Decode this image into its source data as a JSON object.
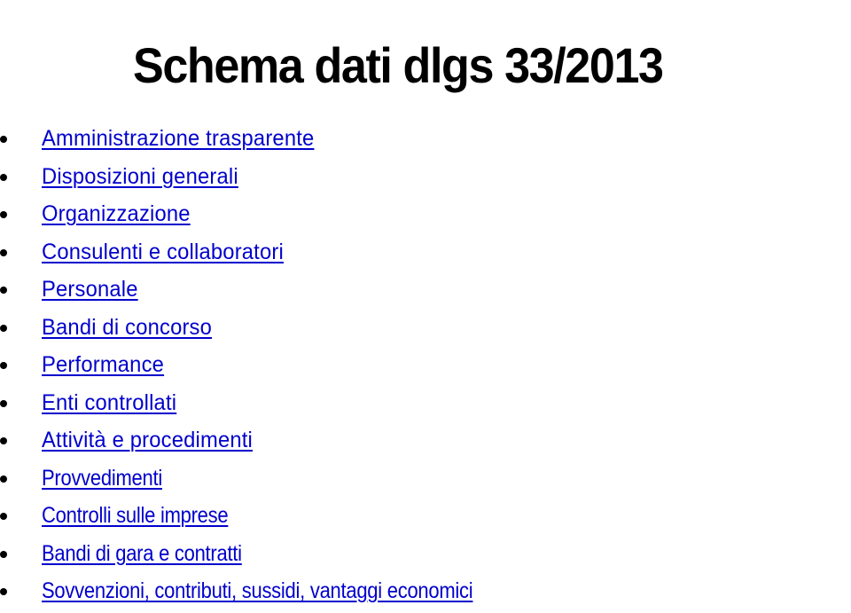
{
  "title": "Schema dati dlgs 33/2013",
  "colors": {
    "link": "#0000cc",
    "text": "#000000",
    "background": "#ffffff"
  },
  "items": [
    {
      "label": "Amministrazione trasparente"
    },
    {
      "label": "Disposizioni generali"
    },
    {
      "label": "Organizzazione"
    },
    {
      "label": "Consulenti e collaboratori"
    },
    {
      "label": "Personale"
    },
    {
      "label": "Bandi di concorso"
    },
    {
      "label": "Performance"
    },
    {
      "label": "Enti controllati"
    },
    {
      "label": "Attività e procedimenti"
    },
    {
      "label": "Provvedimenti"
    },
    {
      "label": "Controlli sulle imprese"
    },
    {
      "label": "Bandi di gara e contratti"
    },
    {
      "label": "Sovvenzioni, contributi, sussidi, vantaggi economici"
    }
  ]
}
